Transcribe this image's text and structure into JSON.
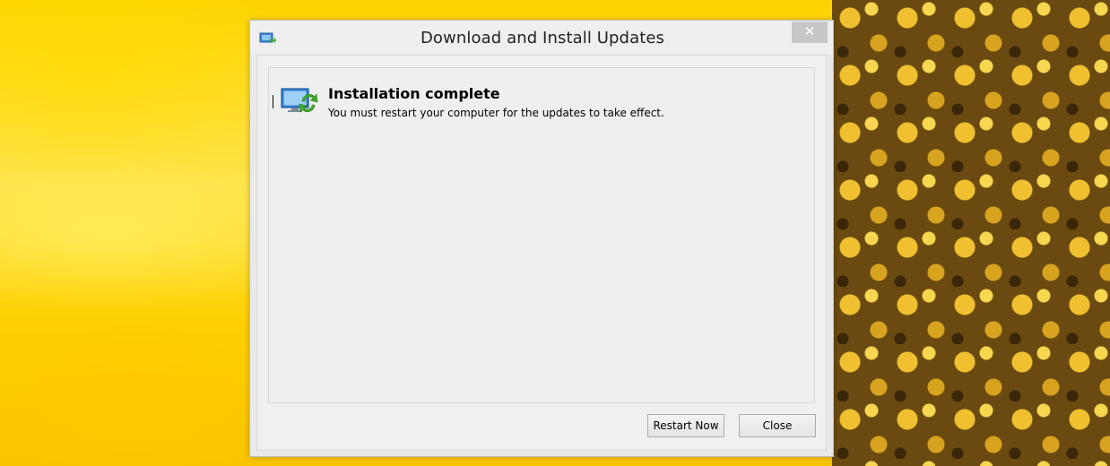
{
  "window": {
    "title": "Download and Install Updates",
    "close_glyph": "✕",
    "title_icon": "windows-update-icon"
  },
  "status": {
    "icon": "update-complete-icon",
    "heading": "Installation complete",
    "message": "You must restart your computer for the updates to take effect."
  },
  "buttons": {
    "restart_label": "Restart Now",
    "close_label": "Close"
  },
  "colors": {
    "accent_green": "#3fae2a",
    "monitor_blue": "#2f7fd0",
    "wallpaper_yellow": "#ffd400"
  }
}
